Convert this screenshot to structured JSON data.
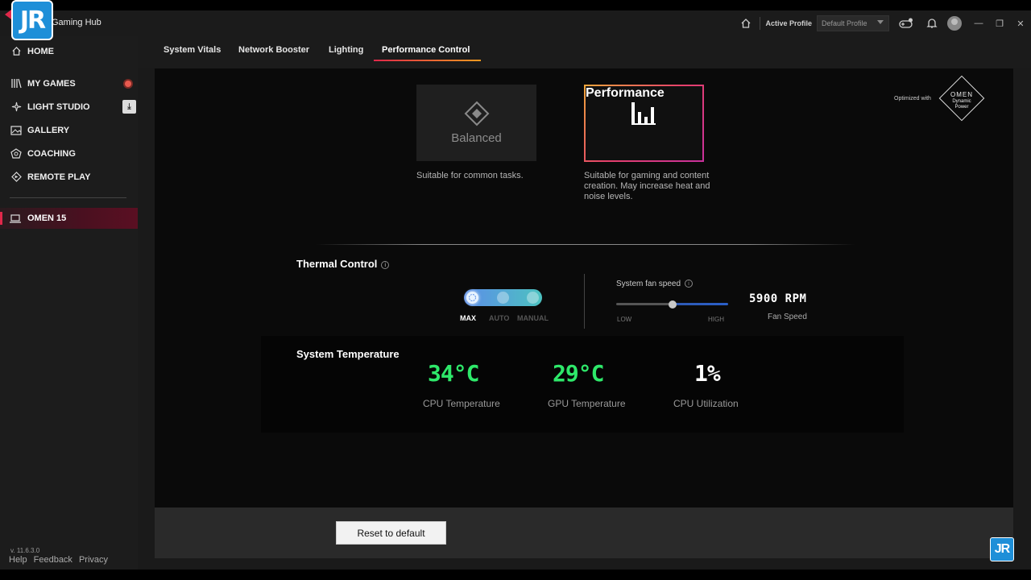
{
  "app": {
    "title": "Gaming Hub",
    "watermark": "JR"
  },
  "titlebar": {
    "active_profile_label": "Active Profile",
    "profile_value": "Default Profile",
    "icons": [
      "home-icon",
      "controller-icon",
      "bell-icon",
      "avatar",
      "minimize-icon",
      "maximize-icon",
      "close-icon"
    ]
  },
  "sidebar": {
    "items": [
      {
        "label": "HOME",
        "icon": "home-icon"
      },
      {
        "label": "MY GAMES",
        "icon": "library-icon"
      },
      {
        "label": "LIGHT STUDIO",
        "icon": "sparkle-icon"
      },
      {
        "label": "GALLERY",
        "icon": "gallery-icon"
      },
      {
        "label": "COACHING",
        "icon": "coaching-icon"
      },
      {
        "label": "REMOTE PLAY",
        "icon": "remote-play-icon"
      }
    ],
    "device": "OMEN 15",
    "version": "v. 11.6.3.0",
    "footer": {
      "help": "Help",
      "feedback": "Feedback",
      "privacy": "Privacy"
    }
  },
  "tabs": [
    {
      "label": "System Vitals"
    },
    {
      "label": "Network Booster"
    },
    {
      "label": "Lighting"
    },
    {
      "label": "Performance Control",
      "active": true
    }
  ],
  "modes": {
    "balanced": {
      "name": "Balanced",
      "desc": "Suitable for common tasks."
    },
    "performance": {
      "name": "Performance",
      "desc": "Suitable for gaming and content creation. May increase heat and noise levels.",
      "selected": true
    }
  },
  "optimized": {
    "label": "Optimized with",
    "badge_line1": "OMEN",
    "badge_line2": "Dynamic Power"
  },
  "thermal": {
    "title": "Thermal Control",
    "modes": [
      "MAX",
      "AUTO",
      "MANUAL"
    ],
    "selected": "MAX",
    "fan_label": "System fan speed",
    "fan_low": "LOW",
    "fan_high": "HIGH",
    "fan_level": 0.5,
    "rpm": "5900 RPM",
    "rpm_label": "Fan Speed"
  },
  "temperature": {
    "title": "System Temperature",
    "cpu_temp": "34°C",
    "cpu_temp_label": "CPU Temperature",
    "gpu_temp": "29°C",
    "gpu_temp_label": "GPU Temperature",
    "cpu_util": "1%",
    "cpu_util_label": "CPU Utilization",
    "value_color": "#2ee86a"
  },
  "actions": {
    "reset": "Reset to default"
  }
}
